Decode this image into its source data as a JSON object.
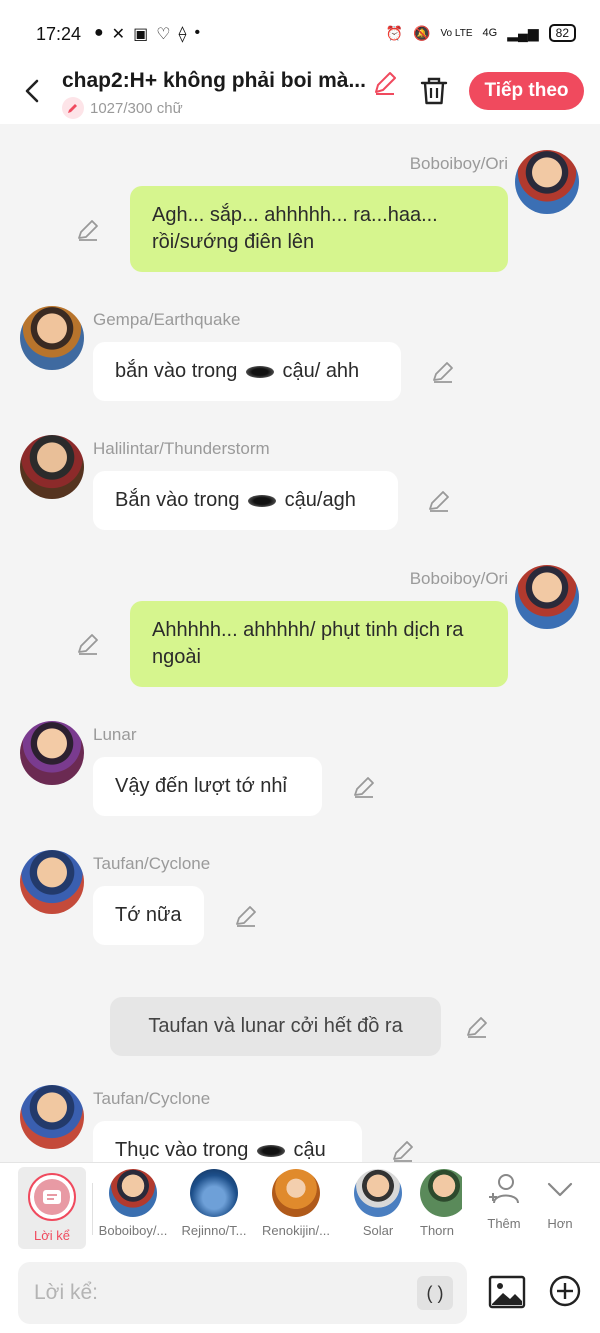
{
  "status_bar": {
    "time": "17:24",
    "signal_text": "4G",
    "volte": "Vo LTE",
    "battery": "82"
  },
  "header": {
    "title": "chap2:H+ không phải boi mà...",
    "word_count": "1027/300 chữ",
    "next_label": "Tiếp theo"
  },
  "messages": [
    {
      "side": "right",
      "name": "Boboiboy/Ori",
      "text": "Agh... sắp... ahhhhh... ra...haa... rồi/sướng điên lên"
    },
    {
      "side": "left",
      "name": "Gempa/Earthquake",
      "text_before": "bắn vào trong",
      "text_after": "cậu/ ahh"
    },
    {
      "side": "left",
      "name": "Halilintar/Thunderstorm",
      "text_before": "Bắn vào trong",
      "text_after": "cậu/agh"
    },
    {
      "side": "right",
      "name": "Boboiboy/Ori",
      "text": "Ahhhhh... ahhhhh/ phụt tinh dịch ra ngoài"
    },
    {
      "side": "left",
      "name": "Lunar",
      "text": "Vậy đến lượt tớ nhỉ"
    },
    {
      "side": "left",
      "name": "Taufan/Cyclone",
      "text": "Tớ nữa"
    },
    {
      "side": "center",
      "text": "Taufan và lunar cởi hết đồ ra"
    },
    {
      "side": "left",
      "name": "Taufan/Cyclone",
      "text_before": "Thục vào trong",
      "text_after": "cậu"
    }
  ],
  "characters": {
    "narrator_label": "Lời kể",
    "items": [
      {
        "label": "Boboiboy/...",
        "color": "#3a6fb0"
      },
      {
        "label": "Rejinno/T...",
        "color": "#1d4f8a"
      },
      {
        "label": "Renokijin/...",
        "color": "#e08a2c"
      },
      {
        "label": "Solar",
        "color": "#4a7ec0"
      },
      {
        "label": "Thorn",
        "color": "#5a8a5a"
      }
    ],
    "add_label": "Thêm",
    "more_label": "Hơn"
  },
  "composer": {
    "placeholder": "Lời kể:",
    "paren_label": "( )"
  },
  "colors": {
    "accent": "#f04a5e",
    "green_bubble": "#d6f58e",
    "white_bubble": "#ffffff",
    "background": "#f4f4f4"
  }
}
